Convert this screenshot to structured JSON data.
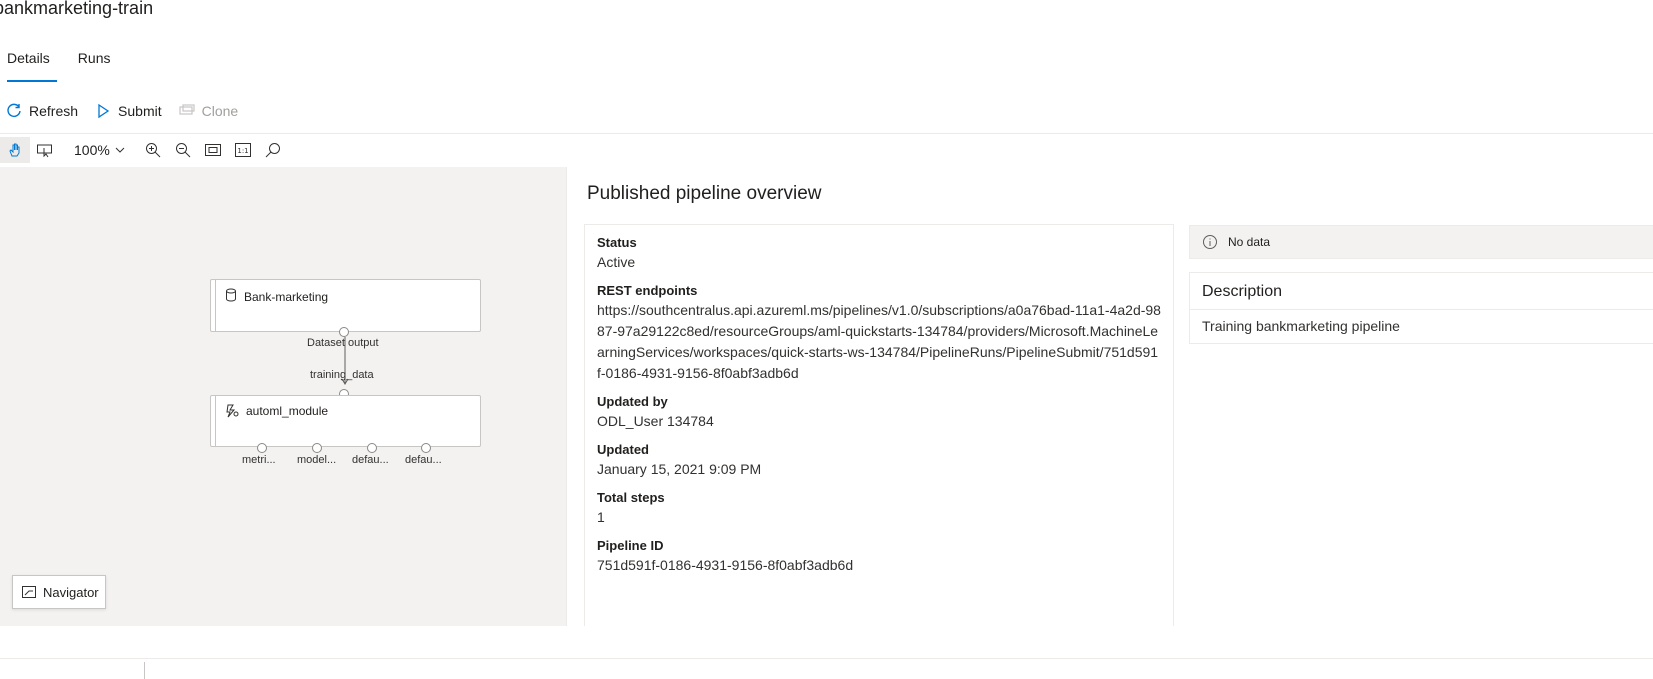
{
  "page": {
    "title": "bankmarketing-train"
  },
  "tabs": [
    {
      "label": "Details",
      "active": true
    },
    {
      "label": "Runs",
      "active": false
    }
  ],
  "commands": {
    "refresh": "Refresh",
    "submit": "Submit",
    "clone": "Clone"
  },
  "toolbar": {
    "zoom": "100%",
    "icons": [
      "pan-hand-icon",
      "select-icon",
      "zoom-in-icon",
      "zoom-out-icon",
      "fit-to-screen-icon",
      "actual-size-icon",
      "search-icon"
    ]
  },
  "graph": {
    "dataset_node": {
      "label": "Bank-marketing",
      "icon": "database-icon"
    },
    "module_node": {
      "label": "automl_module",
      "icon": "automl-icon"
    },
    "edge_output_label": "Dataset output",
    "edge_input_label": "training_data",
    "output_ports": [
      "metri...",
      "model...",
      "defau...",
      "defau..."
    ]
  },
  "navigator": {
    "label": "Navigator"
  },
  "overview": {
    "title": "Published pipeline overview",
    "fields": [
      {
        "label": "Status",
        "value": "Active"
      },
      {
        "label": "REST endpoints",
        "value": "https://southcentralus.api.azureml.ms/pipelines/v1.0/subscriptions/a0a76bad-11a1-4a2d-9887-97a29122c8ed/resourceGroups/aml-quickstarts-134784/providers/Microsoft.MachineLearningServices/workspaces/quick-starts-ws-134784/PipelineRuns/PipelineSubmit/751d591f-0186-4931-9156-8f0abf3adb6d"
      },
      {
        "label": "Updated by",
        "value": "ODL_User 134784"
      },
      {
        "label": "Updated",
        "value": "January 15, 2021 9:09 PM"
      },
      {
        "label": "Total steps",
        "value": "1"
      },
      {
        "label": "Pipeline ID",
        "value": "751d591f-0186-4931-9156-8f0abf3adb6d"
      }
    ],
    "no_data": "No data",
    "description": {
      "header": "Description",
      "text": "Training bankmarketing pipeline"
    }
  },
  "colors": {
    "accent": "#0078d4",
    "canvas_bg": "#f3f2f1"
  }
}
